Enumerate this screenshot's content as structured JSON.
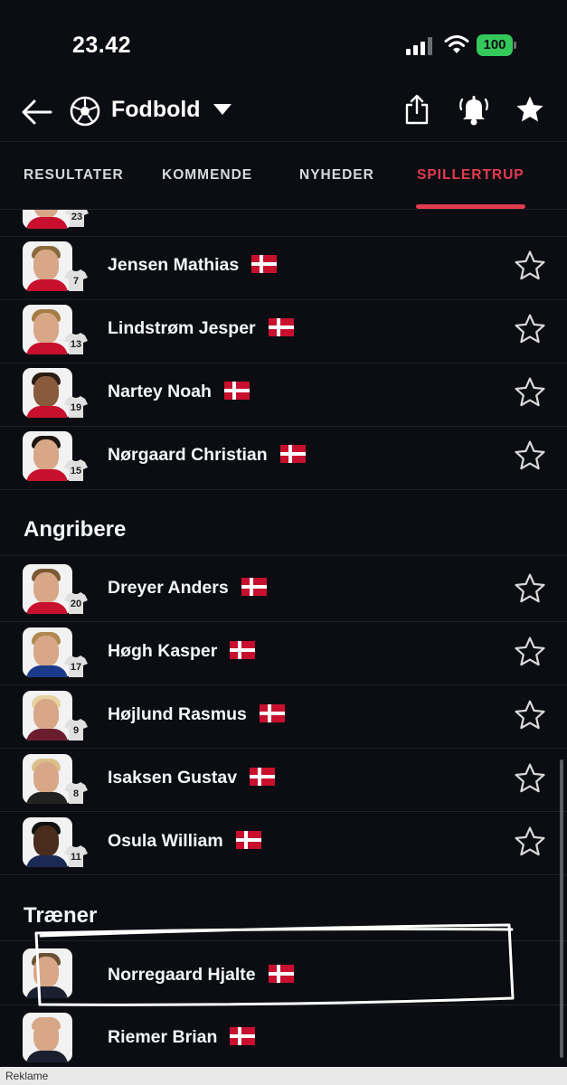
{
  "status": {
    "time": "23.42",
    "battery": "100"
  },
  "header": {
    "title": "Fodbold"
  },
  "tabs": [
    {
      "label": "RESULTATER"
    },
    {
      "label": "KOMMENDE"
    },
    {
      "label": "NYHEDER"
    },
    {
      "label": "SPILLERTRUP",
      "active": true
    }
  ],
  "players_top": [
    {
      "name": "Jensen Mathias",
      "number": "7"
    },
    {
      "name": "Lindstrøm Jesper",
      "number": "13"
    },
    {
      "name": "Nartey Noah",
      "number": "19"
    },
    {
      "name": "Nørgaard Christian",
      "number": "15"
    }
  ],
  "partial_row": {
    "number": "23"
  },
  "section_forwards": "Angribere",
  "forwards": [
    {
      "name": "Dreyer Anders",
      "number": "20"
    },
    {
      "name": "Høgh Kasper",
      "number": "17"
    },
    {
      "name": "Højlund Rasmus",
      "number": "9"
    },
    {
      "name": "Isaksen Gustav",
      "number": "8"
    },
    {
      "name": "Osula William",
      "number": "11"
    }
  ],
  "section_coach": "Træner",
  "coaches": [
    {
      "name": "Norregaard Hjalte"
    },
    {
      "name": "Riemer Brian"
    }
  ],
  "ad_label": "Reklame",
  "colors": {
    "accent": "#e23b4e",
    "background": "#0b0d12",
    "battery": "#34c759"
  }
}
